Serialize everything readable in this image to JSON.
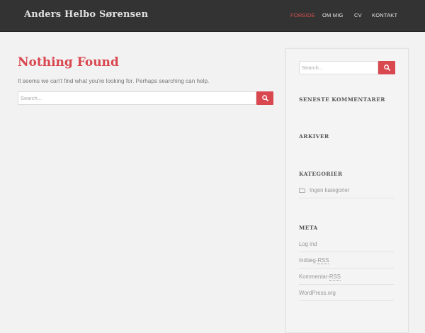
{
  "header": {
    "site_title": "Anders Helbo Sørensen",
    "nav": [
      {
        "label": "FORSIDE",
        "active": true
      },
      {
        "label": "OM MIG",
        "active": false
      },
      {
        "label": "CV",
        "active": false
      },
      {
        "label": "KONTAKT",
        "active": false
      }
    ]
  },
  "main": {
    "title": "Nothing Found",
    "text": "It seems we can't find what you're looking for. Perhaps searching can help.",
    "search_placeholder": "Search..."
  },
  "sidebar": {
    "search_placeholder": "Search...",
    "recent_comments_title": "SENESTE KOMMENTARER",
    "archives_title": "ARKIVER",
    "categories_title": "KATEGORIER",
    "categories_empty": "Ingen kategorier",
    "meta_title": "META",
    "meta": {
      "login": "Log ind",
      "entries_prefix": "Indlæg-",
      "entries_abbr": "RSS",
      "comments_prefix": "Kommentar-",
      "comments_abbr": "RSS",
      "wordpress": "WordPress.org"
    }
  },
  "colors": {
    "accent": "#d9474f",
    "topbar": "#333333",
    "background": "#f2f2f2"
  },
  "icons": {
    "search": "search-icon",
    "folder": "folder-icon"
  }
}
